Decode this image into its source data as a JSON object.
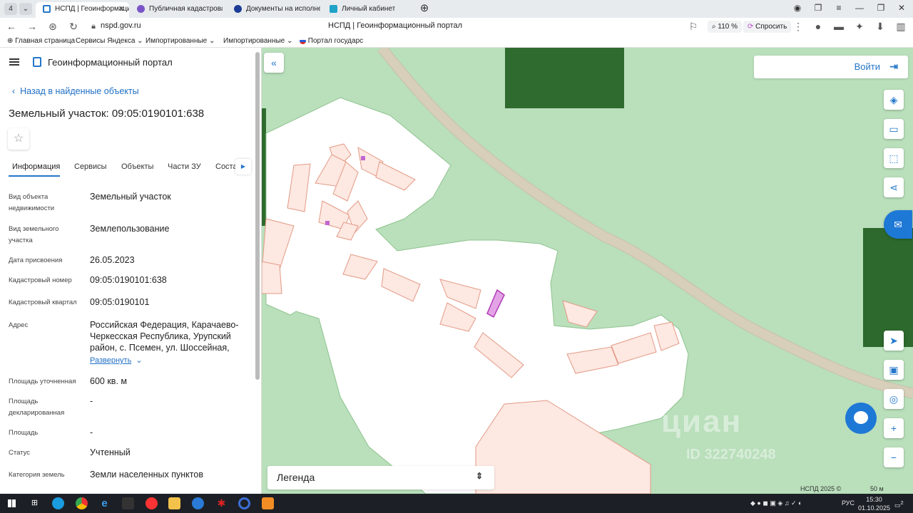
{
  "browser": {
    "tab_counter": "4",
    "tabs": [
      {
        "label": "НСПД | Геоинформаци",
        "active": true
      },
      {
        "label": "Публичная кадастровая"
      },
      {
        "label": "Документы на исполнен"
      },
      {
        "label": "Личный кабинет"
      }
    ],
    "url": "nspd.gov.ru",
    "page_title": "НСПД | Геоинформационный портал",
    "zoom": "110 %",
    "ask_label": "Спросить",
    "bookmarks": [
      "Главная страница",
      "Сервисы Яндекса",
      "Импортированные",
      "Импортированные",
      "Портал государс"
    ]
  },
  "panel": {
    "portal_name": "Геоинформационный портал",
    "back_link": "Назад в найденные объекты",
    "object_title": "Земельный участок: 09:05:0190101:638",
    "tabs": [
      "Информация",
      "Сервисы",
      "Объекты",
      "Части ЗУ",
      "Соста"
    ],
    "fields": [
      {
        "label": "Вид объекта недвижимости",
        "value": "Земельный участок"
      },
      {
        "label": "Вид земельного участка",
        "value": "Землепользование"
      },
      {
        "label": "Дата присвоения",
        "value": "26.05.2023"
      },
      {
        "label": "Кадастровый номер",
        "value": "09:05:0190101:638"
      },
      {
        "label": "Кадастровый квартал",
        "value": "09:05:0190101"
      },
      {
        "label": "Адрес",
        "value": "Российская Федерация, Карачаево-Черкесская Республика, Урупский район, с. Псемен, ул. Шоссейная,"
      },
      {
        "label": "Площадь уточненная",
        "value": "600 кв. м"
      },
      {
        "label": "Площадь декларированная",
        "value": "-"
      },
      {
        "label": "Площадь",
        "value": "-"
      },
      {
        "label": "Статус",
        "value": "Учтенный"
      },
      {
        "label": "Категория земель",
        "value": "Земли населенных пунктов"
      }
    ],
    "expand_label": "Развернуть"
  },
  "map": {
    "login_label": "Войти",
    "legend_label": "Легенда",
    "watermark": "циан",
    "watermark_id": "ID 322740248",
    "copyright": "НСПД 2025 ©",
    "scale_label": "50 м"
  },
  "taskbar": {
    "lang": "РУС",
    "time": "15:30",
    "date": "01.10.2025",
    "notifications": "2"
  }
}
